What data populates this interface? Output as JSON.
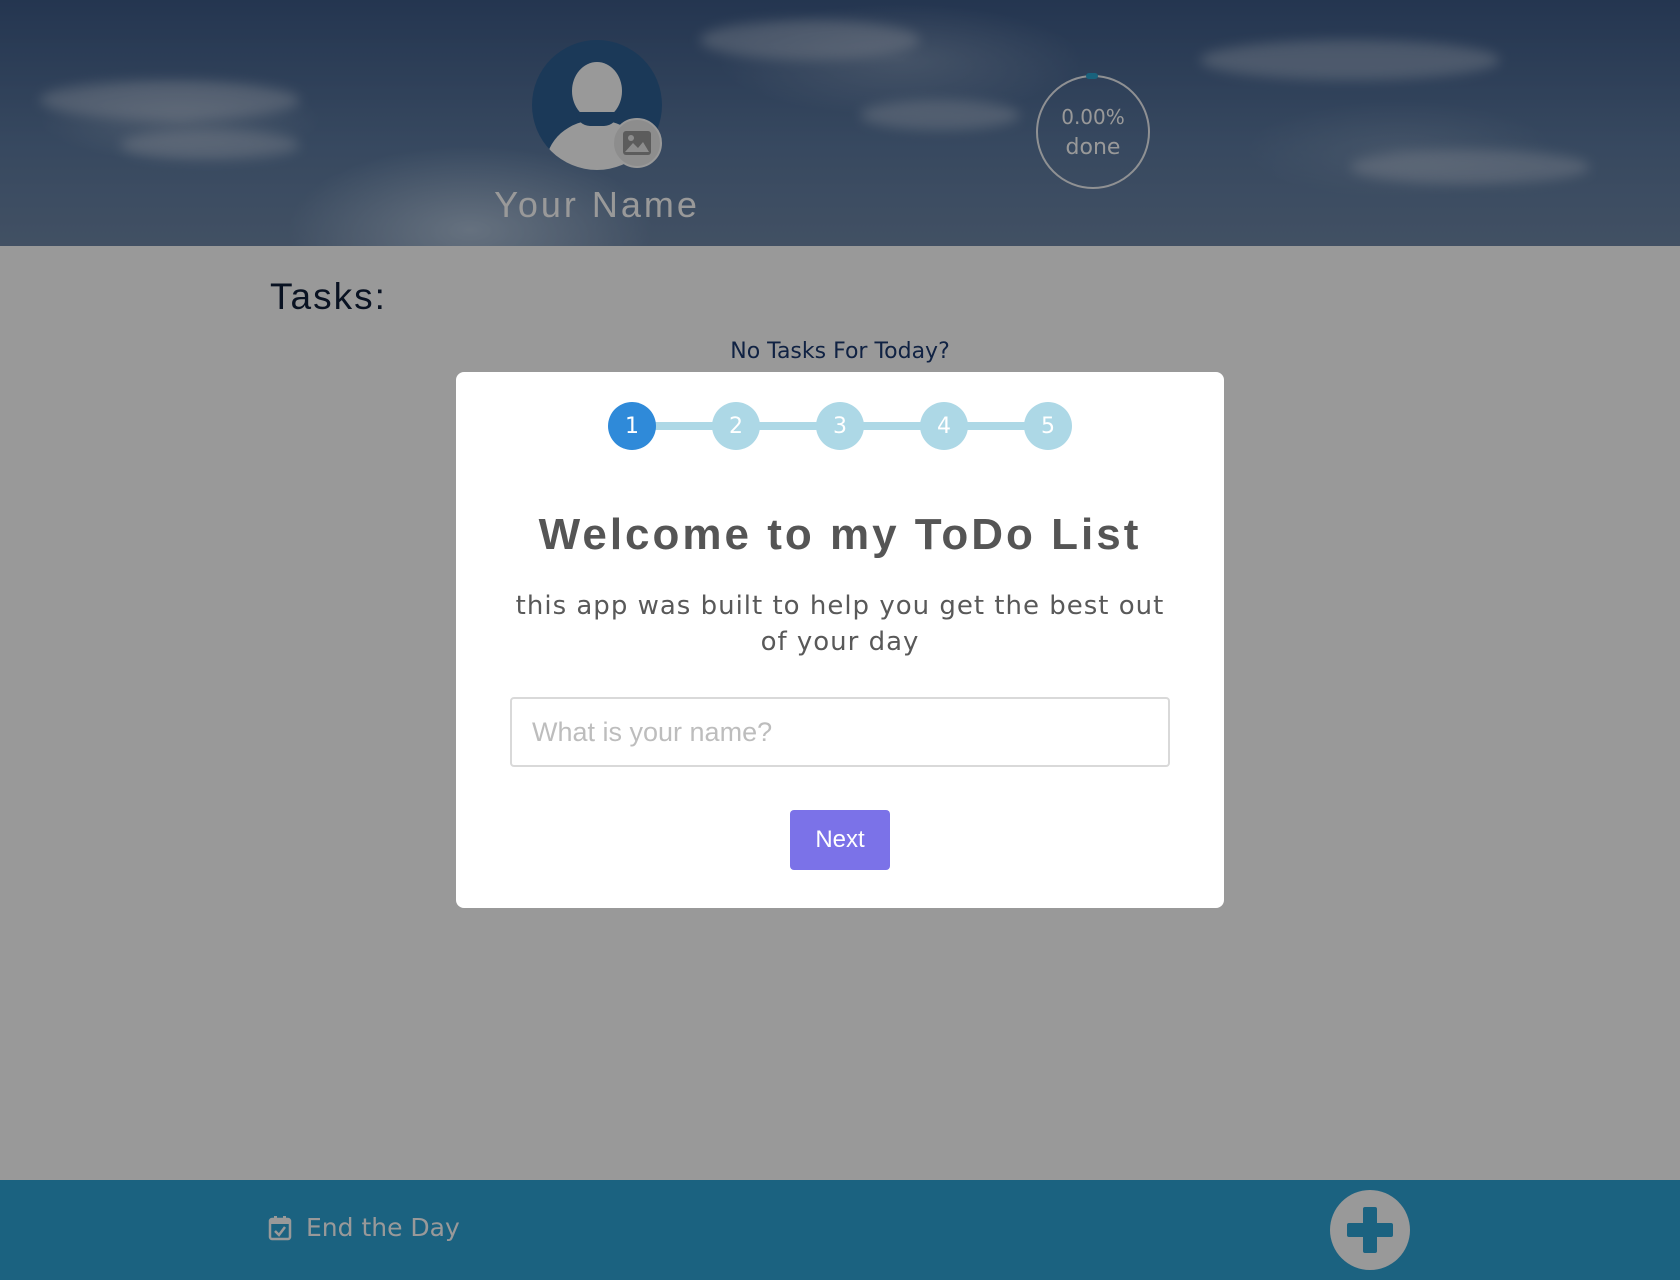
{
  "header": {
    "user_name": "Your Name",
    "progress": {
      "percent_text": "0.00%",
      "label": "done",
      "value": 0
    }
  },
  "main": {
    "tasks_title": "Tasks:",
    "empty_message": "No Tasks For Today?"
  },
  "footer": {
    "end_day_label": "End the Day"
  },
  "modal": {
    "steps": [
      "1",
      "2",
      "3",
      "4",
      "5"
    ],
    "active_step": 1,
    "title": "Welcome to my ToDo List",
    "subtitle": "this app was built to help you get the best out of your day",
    "name_placeholder": "What is your name?",
    "next_label": "Next"
  },
  "colors": {
    "footer": "#2ea3d6",
    "step_active": "#2f8ad9",
    "step_inactive": "#add8e6",
    "next_button": "#7b72e8",
    "overlay": "rgba(0,0,0,0.4)"
  },
  "icons": {
    "avatar": "user-avatar-icon",
    "upload": "image-icon",
    "end_day": "calendar-check-icon",
    "add": "plus-icon"
  }
}
